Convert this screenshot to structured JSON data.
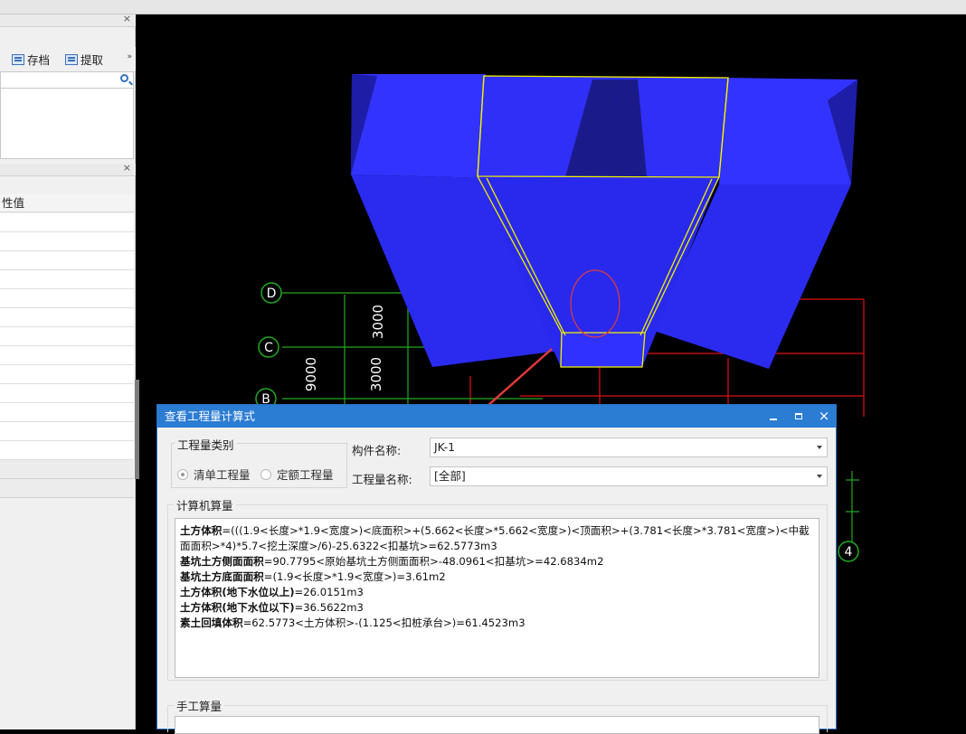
{
  "left_panel": {
    "close_glyph": "×",
    "toolbar": {
      "save_label": "存档",
      "extract_label": "提取",
      "more_glyph": "»"
    },
    "property_header": "性值"
  },
  "viewport": {
    "axis_labels": [
      "D",
      "C",
      "B",
      "4"
    ],
    "dimensions": [
      "3000",
      "3000",
      "9000"
    ]
  },
  "dialog": {
    "title": "查看工程量计算式",
    "quantity_type": {
      "label": "工程量类别",
      "options": [
        "清单工程量",
        "定额工程量"
      ],
      "selected": "清单工程量"
    },
    "component_label": "构件名称:",
    "component_value": "JK-1",
    "quantity_name_label": "工程量名称:",
    "quantity_name_value": "[全部]",
    "computer_section_label": "计算机算量",
    "manual_section_label": "手工算量",
    "calc": {
      "l1_head": "土方体积",
      "l1_body": "=(((1.9<长度>*1.9<宽度>)<底面积>+(5.662<长度>*5.662<宽度>)<顶面积>+(3.781<长度>*3.781<宽度>)<中截面面积>*4)*5.7<挖土深度>/6)-25.6322<扣基坑>=62.5773m3",
      "l2_head": "基坑土方侧面面积",
      "l2_body": "=90.7795<原始基坑土方侧面面积>-48.0961<扣基坑>=42.6834m2",
      "l3_head": "基坑土方底面面积",
      "l3_body": "=(1.9<长度>*1.9<宽度>)=3.61m2",
      "l4_head": "土方体积(地下水位以上)",
      "l4_body": "=26.0151m3",
      "l5_head": "土方体积(地下水位以下)",
      "l5_body": "=36.5622m3",
      "l6_head": "素土回填体积",
      "l6_body": "=62.5773<土方体积>-(1.125<扣桩承台>)=61.4523m3"
    }
  },
  "colors": {
    "title_bar": "#2b7cd3",
    "solid_blue": "#2b2bf0",
    "highlight_yellow": "#f2f200",
    "axis_green": "#22aa22",
    "grid_red": "#e01010",
    "annotation_red": "#e23a3a"
  }
}
